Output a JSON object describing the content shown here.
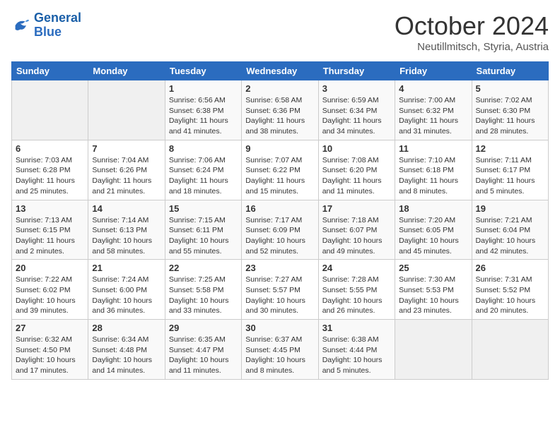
{
  "header": {
    "logo_line1": "General",
    "logo_line2": "Blue",
    "month": "October 2024",
    "location": "Neutillmitsch, Styria, Austria"
  },
  "weekdays": [
    "Sunday",
    "Monday",
    "Tuesday",
    "Wednesday",
    "Thursday",
    "Friday",
    "Saturday"
  ],
  "weeks": [
    [
      {
        "day": "",
        "info": ""
      },
      {
        "day": "",
        "info": ""
      },
      {
        "day": "1",
        "info": "Sunrise: 6:56 AM\nSunset: 6:38 PM\nDaylight: 11 hours and 41 minutes."
      },
      {
        "day": "2",
        "info": "Sunrise: 6:58 AM\nSunset: 6:36 PM\nDaylight: 11 hours and 38 minutes."
      },
      {
        "day": "3",
        "info": "Sunrise: 6:59 AM\nSunset: 6:34 PM\nDaylight: 11 hours and 34 minutes."
      },
      {
        "day": "4",
        "info": "Sunrise: 7:00 AM\nSunset: 6:32 PM\nDaylight: 11 hours and 31 minutes."
      },
      {
        "day": "5",
        "info": "Sunrise: 7:02 AM\nSunset: 6:30 PM\nDaylight: 11 hours and 28 minutes."
      }
    ],
    [
      {
        "day": "6",
        "info": "Sunrise: 7:03 AM\nSunset: 6:28 PM\nDaylight: 11 hours and 25 minutes."
      },
      {
        "day": "7",
        "info": "Sunrise: 7:04 AM\nSunset: 6:26 PM\nDaylight: 11 hours and 21 minutes."
      },
      {
        "day": "8",
        "info": "Sunrise: 7:06 AM\nSunset: 6:24 PM\nDaylight: 11 hours and 18 minutes."
      },
      {
        "day": "9",
        "info": "Sunrise: 7:07 AM\nSunset: 6:22 PM\nDaylight: 11 hours and 15 minutes."
      },
      {
        "day": "10",
        "info": "Sunrise: 7:08 AM\nSunset: 6:20 PM\nDaylight: 11 hours and 11 minutes."
      },
      {
        "day": "11",
        "info": "Sunrise: 7:10 AM\nSunset: 6:18 PM\nDaylight: 11 hours and 8 minutes."
      },
      {
        "day": "12",
        "info": "Sunrise: 7:11 AM\nSunset: 6:17 PM\nDaylight: 11 hours and 5 minutes."
      }
    ],
    [
      {
        "day": "13",
        "info": "Sunrise: 7:13 AM\nSunset: 6:15 PM\nDaylight: 11 hours and 2 minutes."
      },
      {
        "day": "14",
        "info": "Sunrise: 7:14 AM\nSunset: 6:13 PM\nDaylight: 10 hours and 58 minutes."
      },
      {
        "day": "15",
        "info": "Sunrise: 7:15 AM\nSunset: 6:11 PM\nDaylight: 10 hours and 55 minutes."
      },
      {
        "day": "16",
        "info": "Sunrise: 7:17 AM\nSunset: 6:09 PM\nDaylight: 10 hours and 52 minutes."
      },
      {
        "day": "17",
        "info": "Sunrise: 7:18 AM\nSunset: 6:07 PM\nDaylight: 10 hours and 49 minutes."
      },
      {
        "day": "18",
        "info": "Sunrise: 7:20 AM\nSunset: 6:05 PM\nDaylight: 10 hours and 45 minutes."
      },
      {
        "day": "19",
        "info": "Sunrise: 7:21 AM\nSunset: 6:04 PM\nDaylight: 10 hours and 42 minutes."
      }
    ],
    [
      {
        "day": "20",
        "info": "Sunrise: 7:22 AM\nSunset: 6:02 PM\nDaylight: 10 hours and 39 minutes."
      },
      {
        "day": "21",
        "info": "Sunrise: 7:24 AM\nSunset: 6:00 PM\nDaylight: 10 hours and 36 minutes."
      },
      {
        "day": "22",
        "info": "Sunrise: 7:25 AM\nSunset: 5:58 PM\nDaylight: 10 hours and 33 minutes."
      },
      {
        "day": "23",
        "info": "Sunrise: 7:27 AM\nSunset: 5:57 PM\nDaylight: 10 hours and 30 minutes."
      },
      {
        "day": "24",
        "info": "Sunrise: 7:28 AM\nSunset: 5:55 PM\nDaylight: 10 hours and 26 minutes."
      },
      {
        "day": "25",
        "info": "Sunrise: 7:30 AM\nSunset: 5:53 PM\nDaylight: 10 hours and 23 minutes."
      },
      {
        "day": "26",
        "info": "Sunrise: 7:31 AM\nSunset: 5:52 PM\nDaylight: 10 hours and 20 minutes."
      }
    ],
    [
      {
        "day": "27",
        "info": "Sunrise: 6:32 AM\nSunset: 4:50 PM\nDaylight: 10 hours and 17 minutes."
      },
      {
        "day": "28",
        "info": "Sunrise: 6:34 AM\nSunset: 4:48 PM\nDaylight: 10 hours and 14 minutes."
      },
      {
        "day": "29",
        "info": "Sunrise: 6:35 AM\nSunset: 4:47 PM\nDaylight: 10 hours and 11 minutes."
      },
      {
        "day": "30",
        "info": "Sunrise: 6:37 AM\nSunset: 4:45 PM\nDaylight: 10 hours and 8 minutes."
      },
      {
        "day": "31",
        "info": "Sunrise: 6:38 AM\nSunset: 4:44 PM\nDaylight: 10 hours and 5 minutes."
      },
      {
        "day": "",
        "info": ""
      },
      {
        "day": "",
        "info": ""
      }
    ]
  ]
}
